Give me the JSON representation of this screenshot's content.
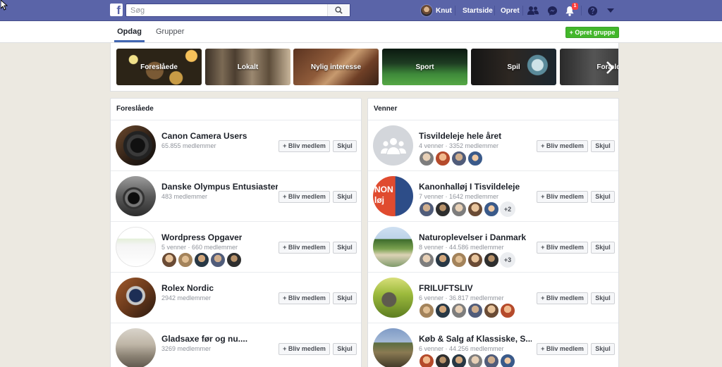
{
  "topbar": {
    "logo": "f",
    "search_placeholder": "Søg",
    "profile_name": "Knut",
    "home_label": "Startside",
    "create_label": "Opret",
    "notification_count": "1",
    "icons": [
      "search-icon",
      "friends-icon",
      "messenger-icon",
      "notifications-icon",
      "help-icon",
      "chevron-down-icon"
    ]
  },
  "subnav": {
    "tabs": [
      {
        "label": "Opdag",
        "active": true
      },
      {
        "label": "Grupper",
        "active": false
      }
    ],
    "create_group_label": "+ Opret gruppe"
  },
  "categories": [
    {
      "label": "Foreslåede"
    },
    {
      "label": "Lokalt"
    },
    {
      "label": "Nylig interesse"
    },
    {
      "label": "Sport"
    },
    {
      "label": "Spil"
    },
    {
      "label": "Forældreskab"
    }
  ],
  "suggested": {
    "title": "Foreslåede",
    "groups": [
      {
        "name": "Canon Camera Users",
        "meta": "65.855 medlemmer",
        "join": "+ Bliv medlem",
        "hide": "Skjul"
      },
      {
        "name": "Danske Olympus Entusiaster",
        "meta": "483 medlemmer",
        "join": "+ Bliv medlem",
        "hide": "Skjul"
      },
      {
        "name": "Wordpress Opgaver",
        "meta": "5 venner · 660 medlemmer",
        "join": "+ Bliv medlem",
        "hide": "Skjul"
      },
      {
        "name": "Rolex Nordic",
        "meta": "2942 medlemmer",
        "join": "+ Bliv medlem",
        "hide": "Skjul"
      },
      {
        "name": "Gladsaxe før og nu....",
        "meta": "3269 medlemmer",
        "join": "+ Bliv medlem",
        "hide": "Skjul"
      }
    ]
  },
  "friends": {
    "title": "Venner",
    "groups": [
      {
        "name": "Tisvildeleje hele året",
        "meta": "4 venner · 3352 medlemmer",
        "join": "+ Bliv medlem",
        "hide": "Skjul"
      },
      {
        "name": "Kanonhalløj I Tisvildeleje",
        "meta": "7 venner · 1642 medlemmer",
        "more": "+2",
        "join": "+ Bliv medlem",
        "hide": "Skjul",
        "avatar_text": "NON løj"
      },
      {
        "name": "Naturoplevelser i Danmark",
        "meta": "8 venner · 44.586 medlemmer",
        "more": "+3",
        "join": "+ Bliv medlem",
        "hide": "Skjul"
      },
      {
        "name": "FRILUFTSLIV",
        "meta": "6 venner · 36.817 medlemmer",
        "join": "+ Bliv medlem",
        "hide": "Skjul"
      },
      {
        "name": "Køb & Salg af Klassiske, S...",
        "meta": "6 venner · 44.256 medlemmer",
        "join": "+ Bliv medlem",
        "hide": "Skjul"
      }
    ]
  }
}
